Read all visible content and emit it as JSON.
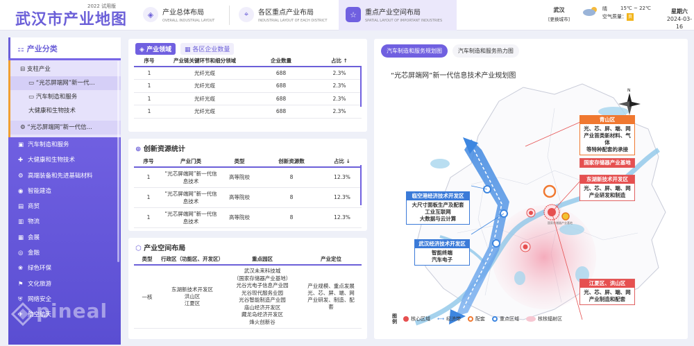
{
  "header": {
    "title": "武汉市产业地图",
    "edition": "2022 试用版",
    "tabs": [
      {
        "label": "产业总体布局",
        "sub": "OVERALL INDUSTRIAL LAYOUT"
      },
      {
        "label": "各区重点产业布局",
        "sub": "INDUSTRIAL LAYOUT OF EACH DISTRICT"
      },
      {
        "label": "重点产业空间布局",
        "sub": "SPATIAL LAYOUT OF IMPORTANT INDUSTRIES"
      }
    ],
    "city": "武汉",
    "city_sub": "[更换城市]",
    "weather": "晴",
    "aqi_label": "空气质量：",
    "aqi": "良",
    "temp": "15℃ ~ 22℃",
    "weekday": "星期六",
    "date": "2024-03-16"
  },
  "sidebar": {
    "title": "产业分类",
    "sub_items": [
      "支柱产业",
      "“光芯屏端网”新一代...",
      "汽车制造和服务",
      "大健康和生物技术",
      "“光芯屏端网”新一代信..."
    ],
    "items": [
      "汽车制造和服务",
      "大健康和生物技术",
      "高端装备和先进基础材料",
      "智能建造",
      "商贸",
      "物流",
      "会展",
      "金融",
      "绿色环保",
      "文化旅游",
      "网络安全",
      "航空航天"
    ]
  },
  "industry": {
    "tabs": [
      "产业领域",
      "各区企业数量"
    ],
    "headers": [
      "序号",
      "产业链关键环节和细分领域",
      "企业数量",
      "占比 ↑"
    ],
    "rows": [
      [
        "1",
        "光纤光缆",
        "688",
        "2.3%"
      ],
      [
        "1",
        "光纤光缆",
        "688",
        "2.3%"
      ],
      [
        "1",
        "光纤光缆",
        "688",
        "2.3%"
      ],
      [
        "1",
        "光纤光缆",
        "688",
        "2.3%"
      ]
    ]
  },
  "innovation": {
    "title": "创新资源统计",
    "headers": [
      "序号",
      "产业门类",
      "类型",
      "创新资源数",
      "占比 ↓"
    ],
    "rows": [
      [
        "1",
        "“光芯屏端网”新一代信息技术",
        "高等院校",
        "8",
        "12.3%"
      ],
      [
        "1",
        "“光芯屏端网”新一代信息技术",
        "高等院校",
        "8",
        "12.3%"
      ],
      [
        "1",
        "“光芯屏端网”新一代信息技术",
        "高等院校",
        "8",
        "12.3%"
      ]
    ]
  },
  "space": {
    "title": "产业空间布局",
    "headers": [
      "类型",
      "行政区（功能区、开发区）",
      "重点园区",
      "产业定位"
    ],
    "row": {
      "type": "一核",
      "district": "东湖新技术开发区\n洪山区\n江夏区",
      "parks": "武汉未来科技城\n（国家存储器产业基地）\n光谷光电子信息产业园\n光谷现代服务业园\n光谷智能制造产业园\n庙山经济开发区\n藏龙岛经济开发区\n烽火创新谷",
      "position": "产业规模、重点发展光、芯、屏、端、网产业研发、制造、配套"
    }
  },
  "map": {
    "tabs": [
      "汽车制造和服务规划图",
      "汽车制造和服务热力图"
    ],
    "title": "“光芯屏端网”新一代信息技术产业规划图",
    "callouts": [
      {
        "h": "青山区",
        "b": "光、芯、屏、端、网\n产业首类新材料、气体\n等特种配套的承接"
      },
      {
        "h": "国家存储器产业基地",
        "b": ""
      },
      {
        "h": "东湖新技术开发区",
        "b": "光、芯、屏、端、网\n产业研发和制造"
      },
      {
        "h": "临空港经济技术开发区",
        "b": "大尺寸面板生产及配套\n工业互联网\n大数据与云计算"
      },
      {
        "h": "武汉经济技术开发区",
        "b": "智能终端\n汽车电子"
      },
      {
        "h": "江夏区、洪山区",
        "b": "光、芯、屏、端、网\n产业制造和配套"
      }
    ],
    "legend": [
      "图例",
      "核心区域",
      "经济带",
      "配套",
      "重点区域",
      "核核辐射区"
    ],
    "center_label": "国家存储器产业基地"
  }
}
